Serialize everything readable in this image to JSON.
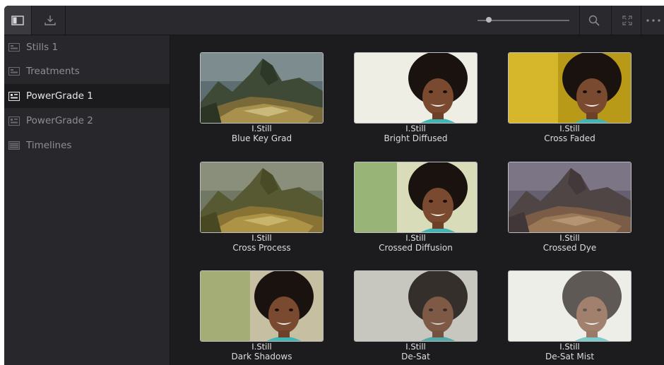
{
  "toolbar": {
    "sidebar_toggle_icon": "sidebar-panel-icon",
    "import_icon": "import-icon",
    "zoom_slider_value": 0.12,
    "search_icon": "search-icon",
    "fullscreen_icon": "fullscreen-icon",
    "more_icon": "more-icon"
  },
  "sidebar": {
    "items": [
      {
        "label": "Stills 1",
        "icon": "still-album-icon",
        "active": false
      },
      {
        "label": "Treatments",
        "icon": "still-album-icon",
        "active": false
      },
      {
        "label": "PowerGrade 1",
        "icon": "powergrade-album-icon",
        "active": true
      },
      {
        "label": "PowerGrade 2",
        "icon": "powergrade-album-icon",
        "active": false
      },
      {
        "label": "Timelines",
        "icon": "timeline-album-icon",
        "active": false
      }
    ]
  },
  "gallery": {
    "stills": [
      {
        "type": "I.Still",
        "name": "Blue Key Grad",
        "image": "landscape"
      },
      {
        "type": "I.Still",
        "name": "Bright Diffused",
        "image": "portrait"
      },
      {
        "type": "I.Still",
        "name": "Cross Faded",
        "image": "portrait"
      },
      {
        "type": "I.Still",
        "name": "Cross Process",
        "image": "landscape"
      },
      {
        "type": "I.Still",
        "name": "Crossed Diffusion",
        "image": "portrait"
      },
      {
        "type": "I.Still",
        "name": "Crossed Dye",
        "image": "landscape"
      },
      {
        "type": "I.Still",
        "name": "Dark Shadows",
        "image": "portrait"
      },
      {
        "type": "I.Still",
        "name": "De-Sat",
        "image": "portrait"
      },
      {
        "type": "I.Still",
        "name": "De-Sat Mist",
        "image": "portrait"
      }
    ]
  },
  "colors": {
    "panel_bg": "#1c1c1f",
    "sidebar_bg": "#28282c",
    "active_item_bg": "#1b1b1e",
    "text_primary": "#e6e6e9",
    "text_dim": "#8e8e93"
  }
}
